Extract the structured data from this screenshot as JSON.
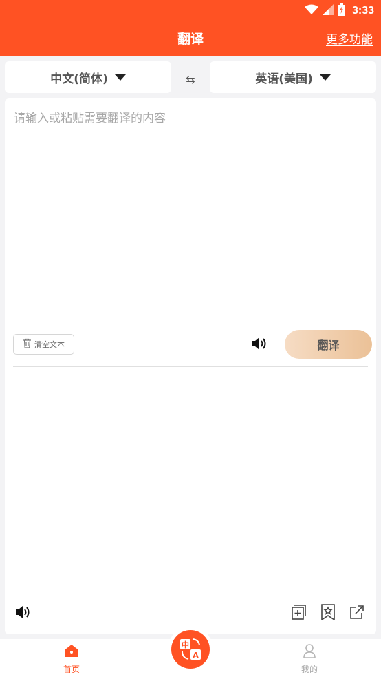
{
  "status": {
    "time": "3:33",
    "icons": [
      "wifi-icon",
      "signal-icon",
      "battery-charging-icon"
    ]
  },
  "header": {
    "title": "翻译",
    "more_label": "更多功能"
  },
  "languages": {
    "source": "中文(简体)",
    "target": "英语(美国)",
    "swap_symbol": "⇆"
  },
  "input": {
    "placeholder": "请输入或粘贴需要翻译的内容",
    "value": ""
  },
  "actions": {
    "clear_label": "清空文本",
    "translate_label": "翻译"
  },
  "output": {
    "text": "",
    "action_icons": [
      "add-to-notebook-icon",
      "favorite-icon",
      "share-icon"
    ]
  },
  "tabbar": {
    "items": [
      {
        "label": "首页",
        "icon": "home-icon",
        "active": true
      },
      {
        "label": "我的",
        "icon": "profile-icon",
        "active": false
      }
    ],
    "center_icon": "translate-app-icon",
    "center_glyphs": [
      "中",
      "A"
    ]
  },
  "colors": {
    "accent": "#ff5223",
    "translate_button_start": "#f6dcc4",
    "translate_button_end": "#ebc197",
    "background": "#f3f3f5"
  }
}
